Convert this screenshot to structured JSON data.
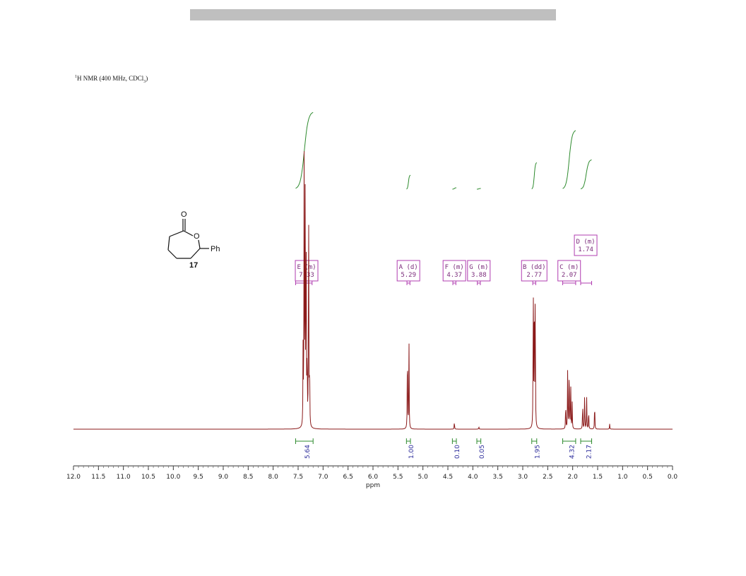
{
  "header_bar": {
    "color": "#bfbfbf"
  },
  "spectrum_title": {
    "sup": "1",
    "text": "H NMR (400 MHz, CDCl",
    "sub": "3",
    "close": ")"
  },
  "structure": {
    "atom_o_carbonyl": "O",
    "atom_o_ring": "O",
    "substituent": "Ph",
    "compound_number": "17"
  },
  "colors": {
    "spectrum": "#8b1a1a",
    "integral_curve": "#2e8b2e",
    "annotation": "#b03cb0",
    "integral_value": "#2a2a9a"
  },
  "chart_data": {
    "type": "line",
    "title": "",
    "xlabel": "ppm",
    "ylabel": "",
    "xlim": [
      12.0,
      0.0
    ],
    "x_reversed": true,
    "x_ticks": [
      "12.0",
      "11.5",
      "11.0",
      "10.5",
      "10.0",
      "9.5",
      "9.0",
      "8.5",
      "8.0",
      "7.5",
      "7.0",
      "6.5",
      "6.0",
      "5.5",
      "5.0",
      "4.5",
      "4.0",
      "3.5",
      "3.0",
      "2.5",
      "2.0",
      "1.5",
      "1.0",
      "0.5",
      "0.0"
    ],
    "peaks": [
      {
        "ppm": 7.38,
        "height": 0.98
      },
      {
        "ppm": 7.36,
        "height": 0.95
      },
      {
        "ppm": 7.34,
        "height": 0.88
      },
      {
        "ppm": 7.29,
        "height": 0.97
      },
      {
        "ppm": 7.4,
        "height": 0.3
      },
      {
        "ppm": 7.32,
        "height": 0.3
      },
      {
        "ppm": 7.27,
        "height": 0.25
      },
      {
        "ppm": 5.31,
        "height": 0.36
      },
      {
        "ppm": 5.28,
        "height": 0.37
      },
      {
        "ppm": 4.37,
        "height": 0.03
      },
      {
        "ppm": 3.88,
        "height": 0.01
      },
      {
        "ppm": 2.79,
        "height": 0.6
      },
      {
        "ppm": 2.77,
        "height": 0.62
      },
      {
        "ppm": 2.75,
        "height": 0.58
      },
      {
        "ppm": 2.14,
        "height": 0.11
      },
      {
        "ppm": 2.1,
        "height": 0.24
      },
      {
        "ppm": 2.07,
        "height": 0.28
      },
      {
        "ppm": 2.04,
        "height": 0.2
      },
      {
        "ppm": 2.01,
        "height": 0.1
      },
      {
        "ppm": 1.8,
        "height": 0.11
      },
      {
        "ppm": 1.76,
        "height": 0.14
      },
      {
        "ppm": 1.72,
        "height": 0.12
      },
      {
        "ppm": 1.68,
        "height": 0.08
      },
      {
        "ppm": 1.56,
        "height": 0.11
      },
      {
        "ppm": 1.26,
        "height": 0.02
      }
    ],
    "multiplets": [
      {
        "label": "E (m)",
        "shift": "7.33",
        "ppm": 7.33,
        "range": [
          7.55,
          7.22
        ],
        "row": 1
      },
      {
        "label": "A (d)",
        "shift": "5.29",
        "ppm": 5.29,
        "range": [
          5.32,
          5.26
        ],
        "row": 1
      },
      {
        "label": "F (m)",
        "shift": "4.37",
        "ppm": 4.37,
        "range": [
          4.4,
          4.34
        ],
        "row": 1
      },
      {
        "label": "G (m)",
        "shift": "3.88",
        "ppm": 3.88,
        "range": [
          3.91,
          3.85
        ],
        "row": 1
      },
      {
        "label": "B (dd)",
        "shift": "2.77",
        "ppm": 2.77,
        "range": [
          2.8,
          2.74
        ],
        "row": 1
      },
      {
        "label": "C (m)",
        "shift": "2.07",
        "ppm": 2.07,
        "range": [
          2.2,
          1.94
        ],
        "row": 1
      },
      {
        "label": "D (m)",
        "shift": "1.74",
        "ppm": 1.74,
        "range": [
          1.84,
          1.62
        ],
        "row": 0
      }
    ],
    "integrals": [
      {
        "value": "5.64",
        "range": [
          7.55,
          7.2
        ]
      },
      {
        "value": "1.00",
        "range": [
          5.33,
          5.25
        ]
      },
      {
        "value": "0.10",
        "range": [
          4.41,
          4.33
        ]
      },
      {
        "value": "0.05",
        "range": [
          3.92,
          3.84
        ]
      },
      {
        "value": "1.95",
        "range": [
          2.82,
          2.72
        ]
      },
      {
        "value": "4.32",
        "range": [
          2.2,
          1.94
        ]
      },
      {
        "value": "2.17",
        "range": [
          1.84,
          1.62
        ]
      }
    ]
  }
}
